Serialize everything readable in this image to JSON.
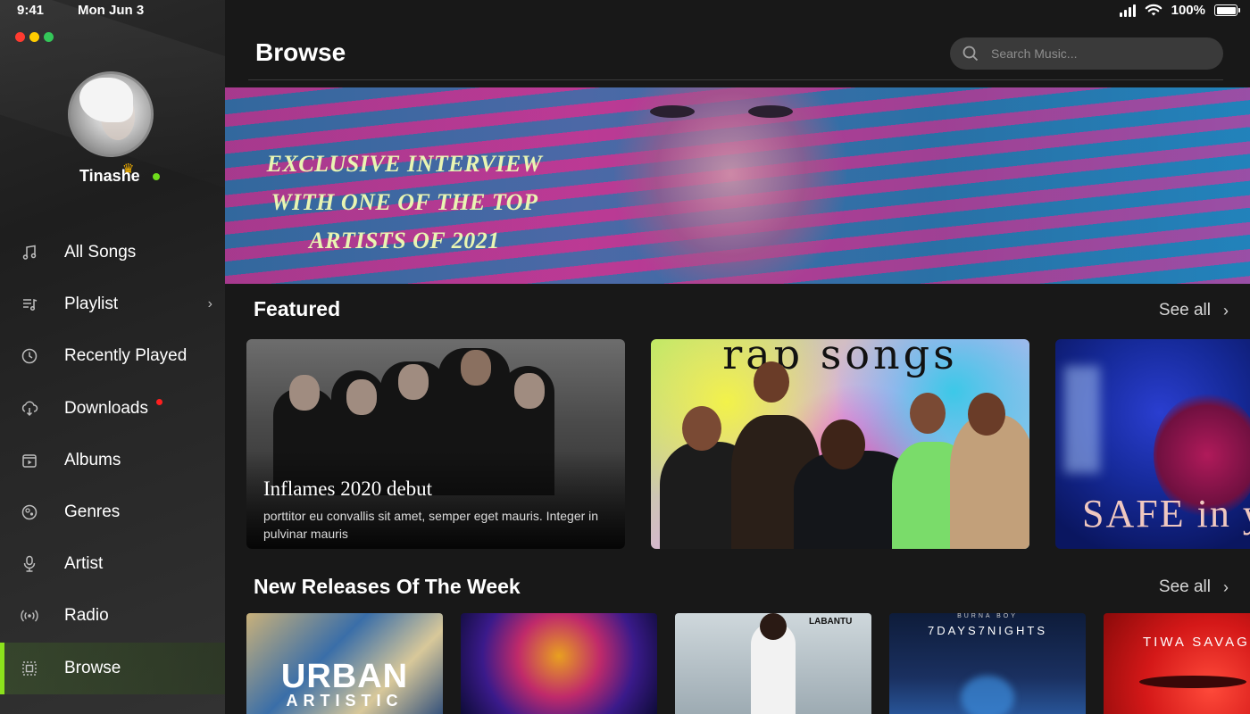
{
  "status_bar": {
    "time": "9:41",
    "date": "Mon Jun 3",
    "battery_text": "100%",
    "icons": [
      "cellular-signal-icon",
      "wifi-icon",
      "battery-icon"
    ]
  },
  "window": {
    "traffic_lights": [
      "#ff3b30",
      "#ffcc00",
      "#34c759"
    ]
  },
  "profile": {
    "name": "Tinashe",
    "status": "online",
    "status_color": "#6fdc1c"
  },
  "sidebar": {
    "items": [
      {
        "label": "All Songs",
        "icon": "music-note-icon"
      },
      {
        "label": "Playlist",
        "icon": "playlist-icon",
        "has_submenu": true
      },
      {
        "label": "Recently Played",
        "icon": "clock-icon"
      },
      {
        "label": "Downloads",
        "icon": "download-cloud-icon",
        "badge": true
      },
      {
        "label": "Albums",
        "icon": "album-icon"
      },
      {
        "label": "Genres",
        "icon": "genres-icon"
      },
      {
        "label": "Artist",
        "icon": "artist-icon"
      },
      {
        "label": "Radio",
        "icon": "radio-icon"
      },
      {
        "label": "Browse",
        "icon": "browse-icon",
        "active": true
      }
    ],
    "accent": "#8ce21c",
    "badge_color": "#ff1f1f"
  },
  "header": {
    "title": "Browse",
    "search_placeholder": "Search Music..."
  },
  "hero": {
    "lines": [
      "EXCLUSIVE INTERVIEW",
      "WITH ONE OF THE TOP",
      "ARTISTS OF 2021"
    ],
    "text_color": "#e9f5b2"
  },
  "featured": {
    "title": "Featured",
    "see_all": "See all",
    "cards": [
      {
        "title": "Inflames 2020 debut",
        "subtitle": "porttitor eu convallis sit amet, semper eget mauris. Integer in pulvinar mauris"
      },
      {
        "image_text": "rap songs"
      },
      {
        "image_text": "SAFE in your AR"
      }
    ]
  },
  "new_releases": {
    "title": "New Releases Of The Week",
    "see_all": "See all",
    "cards": [
      {
        "image_text": "URBAN",
        "image_text_2": "ARTISTIC"
      },
      {
        "image_text": ""
      },
      {
        "image_text": "LABANTU"
      },
      {
        "image_text_small": "BURNA BOY",
        "image_text": "7DAYS7NIGHTS"
      },
      {
        "image_text": "TIWA SAVAG"
      }
    ]
  }
}
